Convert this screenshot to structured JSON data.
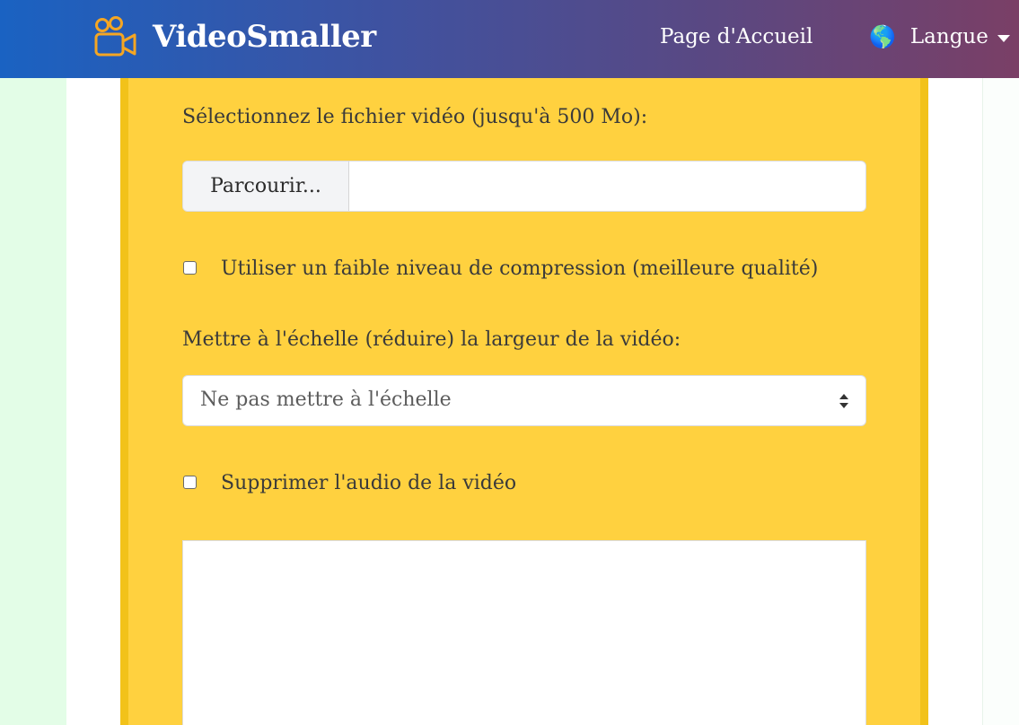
{
  "navbar": {
    "brand_icon": "video-camera-icon",
    "brand_name": "VideoSmaller",
    "home_link": "Page d'Accueil",
    "language_icon": "globe-icon",
    "language_label": "Langue",
    "language_caret_icon": "caret-down-icon",
    "gradient_start": "#1a62c2",
    "gradient_end": "#7a3f66",
    "icon_color": "#f5a623"
  },
  "form": {
    "file_label": "Sélectionnez le fichier vidéo (jusqu'à 500 Mo):",
    "browse_button": "Parcourir...",
    "file_name": "",
    "low_compression_checked": false,
    "low_compression_label": "Utiliser un faible niveau de compression (meilleure qualité)",
    "scale_label": "Mettre à l'échelle (réduire) la largeur de la vidéo:",
    "scale_selected": "Ne pas mettre à l'échelle",
    "remove_audio_checked": false,
    "remove_audio_label": "Supprimer l'audio de la vidéo",
    "card_color": "#ffd13f"
  }
}
